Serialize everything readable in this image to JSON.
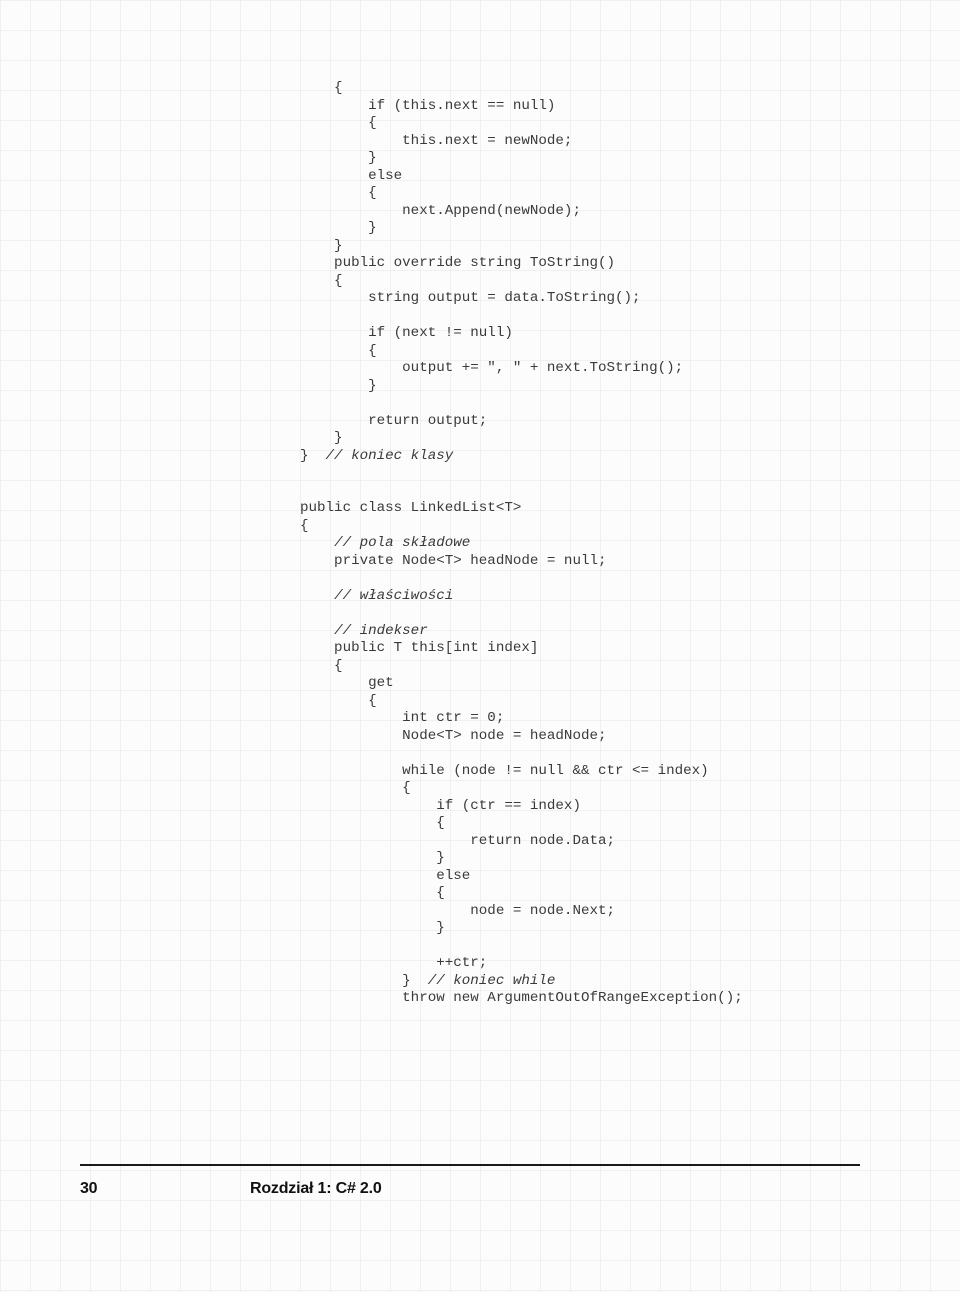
{
  "code": {
    "l1": "    {",
    "l2": "        if (this.next == null)",
    "l3": "        {",
    "l4": "            this.next = newNode;",
    "l5": "        }",
    "l6": "        else",
    "l7": "        {",
    "l8": "            next.Append(newNode);",
    "l9": "        }",
    "l10": "    }",
    "l11": "    public override string ToString()",
    "l12": "    {",
    "l13": "        string output = data.ToString();",
    "l14": "",
    "l15": "        if (next != null)",
    "l16": "        {",
    "l17": "            output += \", \" + next.ToString();",
    "l18": "        }",
    "l19": "",
    "l20": "        return output;",
    "l21": "    }",
    "l22_a": "}  ",
    "l22_b": "// koniec klasy",
    "l23": "",
    "l24": "",
    "l25": "public class LinkedList<T>",
    "l26": "{",
    "l27_a": "    ",
    "l27_b": "// pola składowe",
    "l28": "    private Node<T> headNode = null;",
    "l29": "",
    "l30_a": "    ",
    "l30_b": "// właściwości",
    "l31": "",
    "l32_a": "    ",
    "l32_b": "// indekser",
    "l33": "    public T this[int index]",
    "l34": "    {",
    "l35": "        get",
    "l36": "        {",
    "l37": "            int ctr = 0;",
    "l38": "            Node<T> node = headNode;",
    "l39": "",
    "l40": "            while (node != null && ctr <= index)",
    "l41": "            {",
    "l42": "                if (ctr == index)",
    "l43": "                {",
    "l44": "                    return node.Data;",
    "l45": "                }",
    "l46": "                else",
    "l47": "                {",
    "l48": "                    node = node.Next;",
    "l49": "                }",
    "l50": "",
    "l51": "                ++ctr;",
    "l52_a": "            }  ",
    "l52_b": "// koniec while",
    "l53": "            throw new ArgumentOutOfRangeException();"
  },
  "footer": {
    "page": "30",
    "chapter": "Rozdział 1: C# 2.0"
  }
}
